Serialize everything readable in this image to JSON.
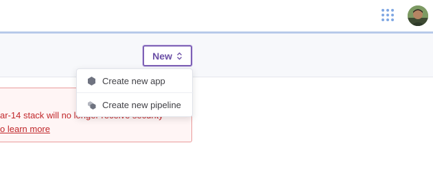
{
  "header": {
    "apps_icon": "apps-grid-icon",
    "avatar_icon": "user-avatar"
  },
  "toolbar": {
    "new_label": "New",
    "new_icon": "chevron-up-down-icon"
  },
  "dropdown": {
    "items": [
      {
        "label": "Create new app",
        "icon": "app-hexagon-icon"
      },
      {
        "label": "Create new pipeline",
        "icon": "pipeline-hexagons-icon"
      }
    ]
  },
  "alert": {
    "text": "ar-14 stack will no longer receive security",
    "link": "o learn more"
  },
  "colors": {
    "accent": "#6b4fa6",
    "alert_text": "#c0262a",
    "alert_border": "#e99a9a",
    "topbar_line": "#b7c9e9"
  }
}
